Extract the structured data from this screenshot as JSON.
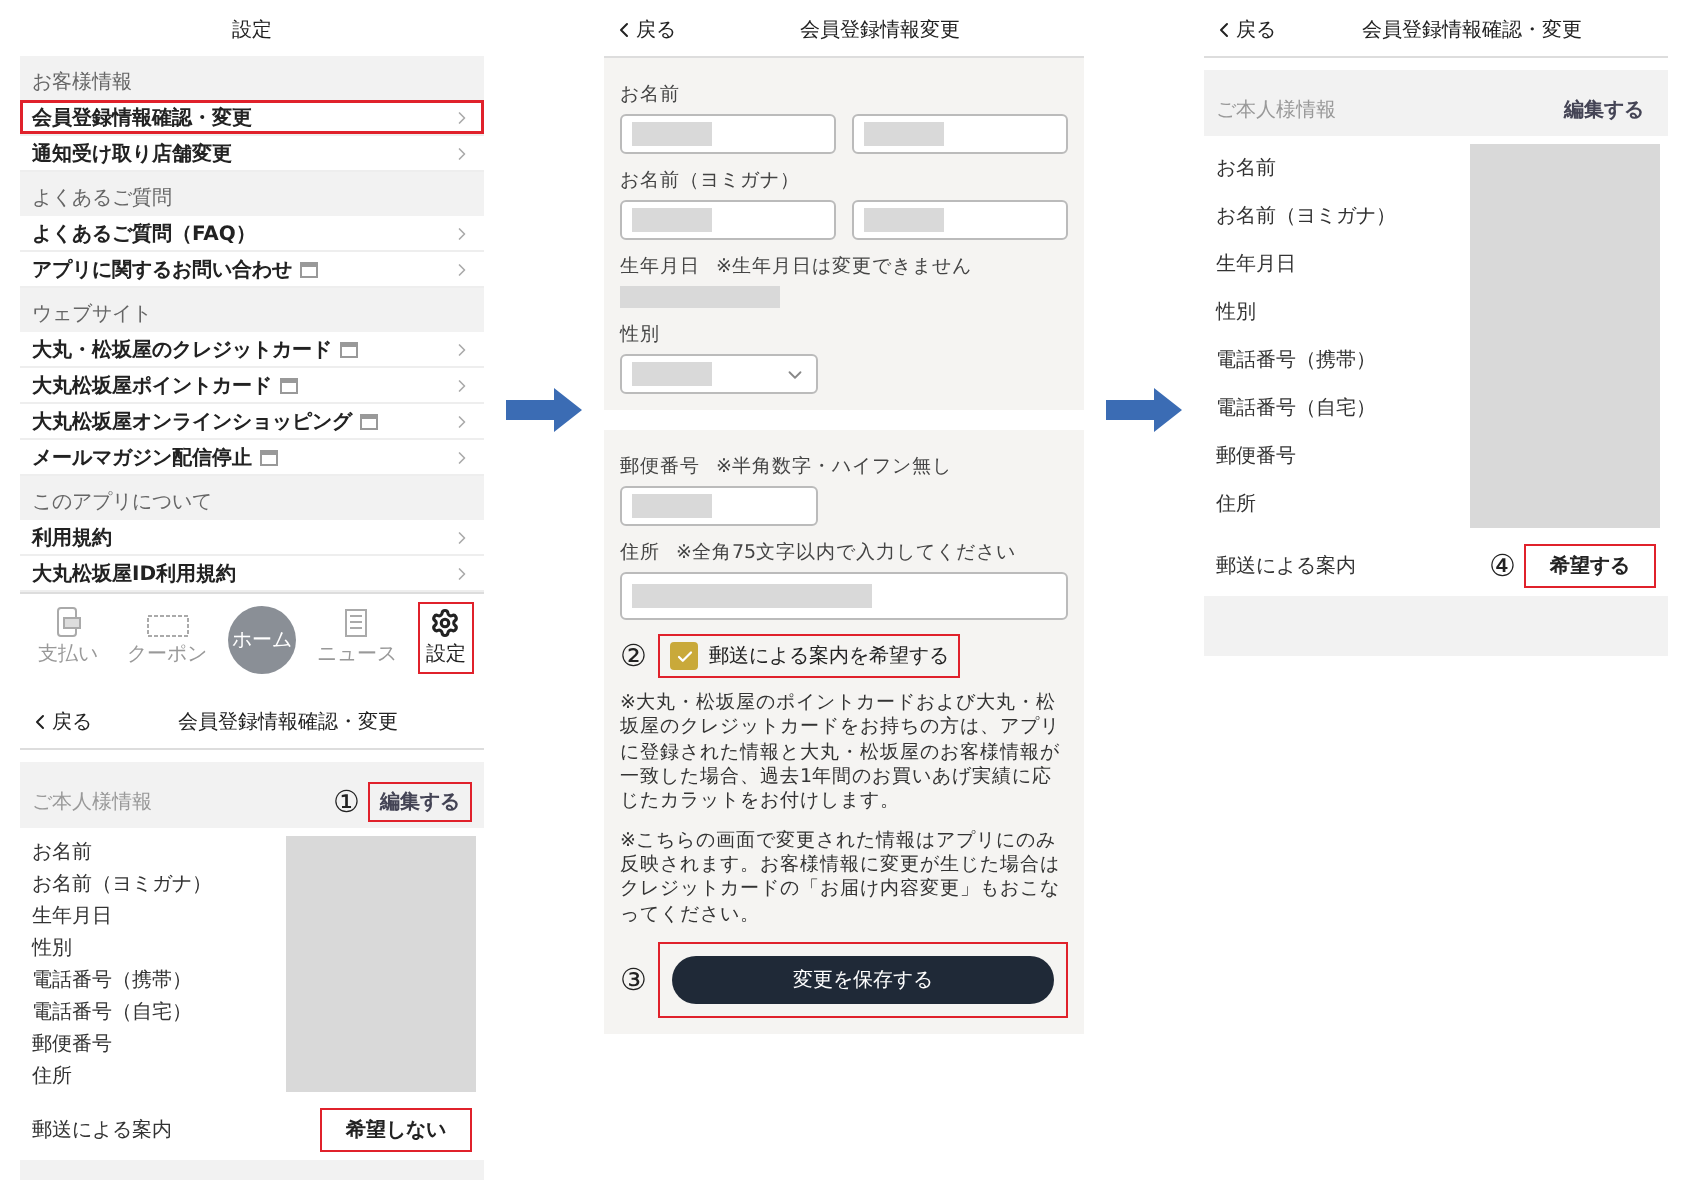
{
  "settings_screen": {
    "title": "設定",
    "sections": [
      {
        "header": "お客様情報",
        "items": [
          {
            "label": "会員登録情報確認・変更",
            "external": false,
            "highlighted": true
          },
          {
            "label": "通知受け取り店舗変更",
            "external": false,
            "highlighted": false
          }
        ]
      },
      {
        "header": "よくあるご質問",
        "items": [
          {
            "label": "よくあるご質問（FAQ）",
            "external": false,
            "highlighted": false
          },
          {
            "label": "アプリに関するお問い合わせ",
            "external": true,
            "highlighted": false
          }
        ]
      },
      {
        "header": "ウェブサイト",
        "items": [
          {
            "label": "大丸・松坂屋のクレジットカード",
            "external": true,
            "highlighted": false
          },
          {
            "label": "大丸松坂屋ポイントカード",
            "external": true,
            "highlighted": false
          },
          {
            "label": "大丸松坂屋オンラインショッピング",
            "external": true,
            "highlighted": false
          },
          {
            "label": "メールマガジン配信停止",
            "external": true,
            "highlighted": false
          }
        ]
      },
      {
        "header": "このアプリについて",
        "items": [
          {
            "label": "利用規約",
            "external": false,
            "highlighted": false
          },
          {
            "label": "大丸松坂屋ID利用規約",
            "external": false,
            "highlighted": false
          }
        ]
      }
    ],
    "tab_bar": [
      {
        "kind": "payment",
        "label": "支払い",
        "selected": false,
        "highlighted": false
      },
      {
        "kind": "coupon",
        "label": "クーポン",
        "selected": false,
        "highlighted": false
      },
      {
        "kind": "home",
        "label": "ホーム",
        "selected": false,
        "highlighted": false
      },
      {
        "kind": "news",
        "label": "ニュース",
        "selected": false,
        "highlighted": false
      },
      {
        "kind": "settings",
        "label": "設定",
        "selected": true,
        "highlighted": true
      }
    ]
  },
  "profile_before": {
    "back": "戻る",
    "title": "会員登録情報確認・変更",
    "section": "ご本人様情報",
    "edit": {
      "label": "編集する",
      "highlighted": true,
      "step": "①"
    },
    "fields": [
      "お名前",
      "お名前（ヨミガナ）",
      "生年月日",
      "性別",
      "電話番号（携帯）",
      "電話番号（自宅）",
      "郵便番号",
      "住所"
    ],
    "mail": {
      "label": "郵送による案内",
      "value": "希望しない",
      "highlighted": true
    }
  },
  "edit_screen": {
    "back": "戻る",
    "title": "会員登録情報変更",
    "name": {
      "label": "お名前"
    },
    "kana": {
      "label": "お名前（ヨミガナ）"
    },
    "birth": {
      "label": "生年月日",
      "note": "※生年月日は変更できません"
    },
    "gender": {
      "label": "性別"
    },
    "postal": {
      "label": "郵便番号",
      "note": "※半角数字・ハイフン無し"
    },
    "address": {
      "label": "住所",
      "note": "※全角75文字以内で入力してください"
    },
    "mail_opt_in": {
      "label": "郵送による案内を希望する",
      "checked": true,
      "highlighted": true,
      "step": "②"
    },
    "notes": [
      "※大丸・松坂屋のポイントカードおよび大丸・松坂屋のクレジットカードをお持ちの方は、アプリに登録された情報と大丸・松坂屋のお客様情報が一致した場合、過去1年間のお買いあげ実績に応じたカラットをお付けします。",
      "※こちらの画面で変更された情報はアプリにのみ反映されます。お客様情報に変更が生じた場合はクレジットカードの「お届け内容変更」もおこなってください。"
    ],
    "save": {
      "label": "変更を保存する",
      "highlighted": true,
      "step": "③"
    }
  },
  "profile_after": {
    "back": "戻る",
    "title": "会員登録情報確認・変更",
    "section": "ご本人様情報",
    "edit": {
      "label": "編集する",
      "highlighted": false
    },
    "fields": [
      "お名前",
      "お名前（ヨミガナ）",
      "生年月日",
      "性別",
      "電話番号（携帯）",
      "電話番号（自宅）",
      "郵便番号",
      "住所"
    ],
    "mail": {
      "label": "郵送による案内",
      "value": "希望する",
      "highlighted": true,
      "step": "④"
    }
  }
}
